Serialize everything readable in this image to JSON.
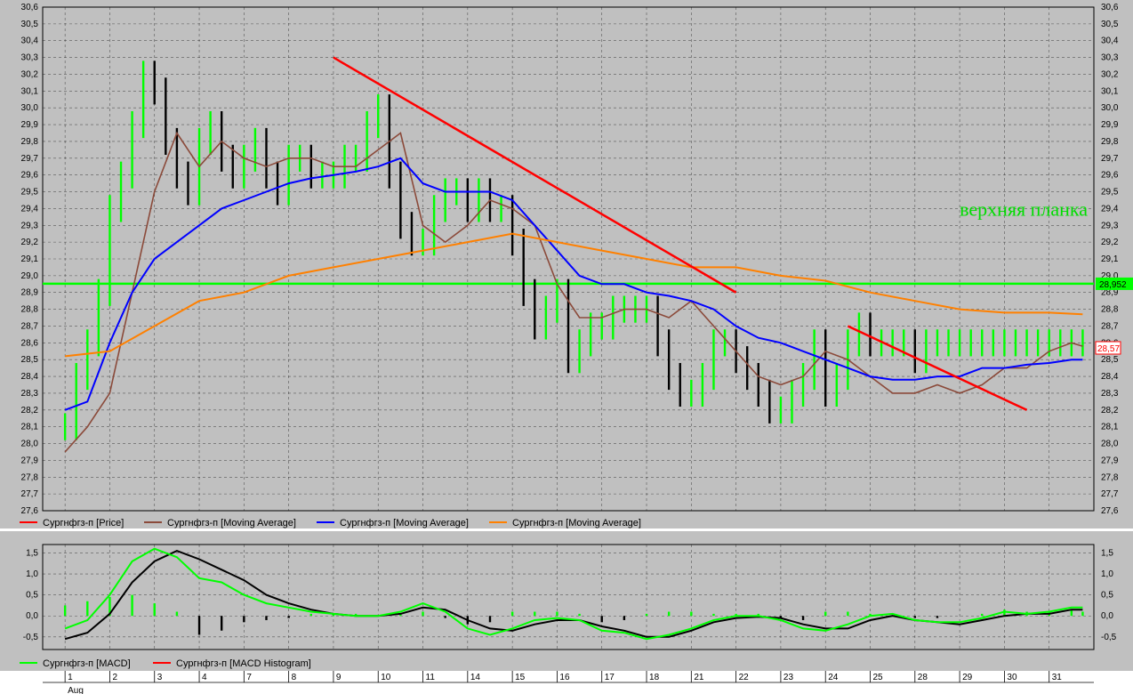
{
  "chart_data": [
    {
      "type": "line",
      "panel": "price",
      "ylim": [
        27.6,
        30.6
      ],
      "yticks": [
        27.6,
        27.7,
        27.8,
        27.9,
        28.0,
        28.1,
        28.2,
        28.3,
        28.4,
        28.5,
        28.6,
        28.7,
        28.8,
        28.9,
        29.0,
        29.1,
        29.2,
        29.3,
        29.4,
        29.5,
        29.6,
        29.7,
        29.8,
        29.9,
        30.0,
        30.1,
        30.2,
        30.3,
        30.4,
        30.5,
        30.6
      ],
      "ytick_labels": [
        "27,6",
        "27,7",
        "27,8",
        "27,9",
        "28,0",
        "28,1",
        "28,2",
        "28,3",
        "28,4",
        "28,5",
        "28,6",
        "28,7",
        "28,8",
        "28,9",
        "29,0",
        "29,1",
        "29,2",
        "29,3",
        "29,4",
        "29,5",
        "29,6",
        "29,7",
        "29,8",
        "29,9",
        "30,0",
        "30,1",
        "30,2",
        "30,3",
        "30,4",
        "30,5",
        "30,6"
      ],
      "grid": true,
      "x_categories": [
        "1",
        "2",
        "3",
        "4",
        "7",
        "8",
        "9",
        "10",
        "11",
        "14",
        "15",
        "16",
        "17",
        "18",
        "21",
        "22",
        "23",
        "24",
        "25",
        "28",
        "29",
        "30",
        "31"
      ],
      "x_month_label": "Aug",
      "series": [
        {
          "name": "Сургнфгз-п [Price]",
          "color": "#00ff00",
          "style": "bars",
          "x": [
            0,
            0.25,
            0.5,
            0.75,
            1,
            1.25,
            1.5,
            1.75,
            2,
            2.25,
            2.5,
            2.75,
            3,
            3.25,
            3.5,
            3.75,
            4,
            4.25,
            4.5,
            4.75,
            5,
            5.25,
            5.5,
            5.75,
            6,
            6.25,
            6.5,
            6.75,
            7,
            7.25,
            7.5,
            7.75,
            8,
            8.25,
            8.5,
            8.75,
            9,
            9.25,
            9.5,
            9.75,
            10,
            10.25,
            10.5,
            10.75,
            11,
            11.25,
            11.5,
            11.75,
            12,
            12.25,
            12.5,
            12.75,
            13,
            13.25,
            13.5,
            13.75,
            14,
            14.25,
            14.5,
            14.75,
            15,
            15.25,
            15.5,
            15.75,
            16,
            16.25,
            16.5,
            16.75,
            17,
            17.25,
            17.5,
            17.75,
            18,
            18.25,
            18.5,
            18.75,
            19,
            19.25,
            19.5,
            19.75,
            20,
            20.25,
            20.5,
            20.75,
            21,
            21.25,
            21.5,
            21.75,
            22,
            22.25,
            22.5,
            22.75
          ],
          "close": [
            28.1,
            28.4,
            28.6,
            28.9,
            29.4,
            29.6,
            29.9,
            30.2,
            30.1,
            29.8,
            29.6,
            29.5,
            29.8,
            29.9,
            29.7,
            29.6,
            29.7,
            29.8,
            29.6,
            29.5,
            29.7,
            29.7,
            29.6,
            29.6,
            29.6,
            29.7,
            29.7,
            29.9,
            30.0,
            29.6,
            29.3,
            29.2,
            29.2,
            29.4,
            29.5,
            29.5,
            29.4,
            29.5,
            29.4,
            29.4,
            29.2,
            28.9,
            28.7,
            28.8,
            28.9,
            28.5,
            28.6,
            28.7,
            28.7,
            28.8,
            28.8,
            28.8,
            28.8,
            28.6,
            28.4,
            28.3,
            28.3,
            28.4,
            28.6,
            28.6,
            28.5,
            28.4,
            28.3,
            28.2,
            28.2,
            28.3,
            28.4,
            28.6,
            28.3,
            28.4,
            28.6,
            28.7,
            28.6,
            28.6,
            28.6,
            28.6,
            28.5,
            28.6,
            28.6,
            28.6,
            28.6,
            28.6,
            28.6,
            28.6,
            28.6,
            28.6,
            28.6,
            28.6,
            28.6,
            28.6,
            28.6,
            28.6
          ]
        },
        {
          "name": "Сургнфгз-п [Moving Average]",
          "color": "#8b4a3a",
          "x": [
            0,
            0.5,
            1,
            1.5,
            2,
            2.5,
            3,
            3.5,
            4,
            4.5,
            5,
            5.5,
            6,
            6.5,
            7,
            7.5,
            8,
            8.5,
            9,
            9.5,
            10,
            10.5,
            11,
            11.5,
            12,
            12.5,
            13,
            13.5,
            14,
            14.5,
            15,
            15.5,
            16,
            16.5,
            17,
            17.5,
            18,
            18.5,
            19,
            19.5,
            20,
            20.5,
            21,
            21.5,
            22,
            22.5,
            22.75
          ],
          "values": [
            27.95,
            28.1,
            28.3,
            28.9,
            29.5,
            29.85,
            29.65,
            29.8,
            29.7,
            29.65,
            29.7,
            29.7,
            29.65,
            29.65,
            29.75,
            29.85,
            29.3,
            29.2,
            29.3,
            29.45,
            29.4,
            29.3,
            28.95,
            28.75,
            28.75,
            28.8,
            28.8,
            28.75,
            28.85,
            28.7,
            28.55,
            28.4,
            28.35,
            28.4,
            28.55,
            28.5,
            28.4,
            28.3,
            28.3,
            28.35,
            28.3,
            28.35,
            28.45,
            28.45,
            28.55,
            28.6,
            28.58
          ]
        },
        {
          "name": "Сургнфгз-п [Moving Average]",
          "color": "#0000ff",
          "x": [
            0,
            0.5,
            1,
            1.5,
            2,
            2.5,
            3,
            3.5,
            4,
            4.5,
            5,
            5.5,
            6,
            6.5,
            7,
            7.5,
            8,
            8.5,
            9,
            9.5,
            10,
            10.5,
            11,
            11.5,
            12,
            12.5,
            13,
            13.5,
            14,
            14.5,
            15,
            15.5,
            16,
            16.5,
            17,
            17.5,
            18,
            18.5,
            19,
            19.5,
            20,
            20.5,
            21,
            21.5,
            22,
            22.5,
            22.75
          ],
          "values": [
            28.2,
            28.25,
            28.6,
            28.9,
            29.1,
            29.2,
            29.3,
            29.4,
            29.45,
            29.5,
            29.55,
            29.58,
            29.6,
            29.62,
            29.65,
            29.7,
            29.55,
            29.5,
            29.5,
            29.5,
            29.45,
            29.3,
            29.15,
            29.0,
            28.95,
            28.95,
            28.9,
            28.88,
            28.85,
            28.8,
            28.7,
            28.63,
            28.6,
            28.55,
            28.5,
            28.45,
            28.4,
            28.38,
            28.38,
            28.4,
            28.4,
            28.45,
            28.45,
            28.47,
            28.48,
            28.5,
            28.5
          ]
        },
        {
          "name": "Сургнфгз-п [Moving Average]",
          "color": "#ff8000",
          "x": [
            0,
            1,
            2,
            3,
            4,
            5,
            6,
            7,
            8,
            9,
            10,
            11,
            12,
            13,
            14,
            15,
            16,
            17,
            18,
            19,
            20,
            21,
            22,
            22.75
          ],
          "values": [
            28.52,
            28.55,
            28.7,
            28.85,
            28.9,
            29.0,
            29.05,
            29.1,
            29.15,
            29.2,
            29.25,
            29.2,
            29.15,
            29.1,
            29.05,
            29.05,
            29.0,
            28.97,
            28.9,
            28.85,
            28.8,
            28.78,
            28.78,
            28.77
          ]
        }
      ],
      "annotations": [
        {
          "type": "hline",
          "value": 28.952,
          "color": "#00ff00",
          "label": "28,952"
        },
        {
          "type": "trendline",
          "color": "#ff0000",
          "x": [
            6,
            15
          ],
          "values": [
            30.3,
            28.9
          ]
        },
        {
          "type": "trendline",
          "color": "#ff0000",
          "x": [
            17.5,
            21.5
          ],
          "values": [
            28.7,
            28.2
          ]
        },
        {
          "type": "text",
          "text": "верхняя планка",
          "color": "#00dd00",
          "x": 20.0,
          "value": 29.4
        },
        {
          "type": "price_marker",
          "value": 28.57,
          "label": "28,57",
          "color": "#ff0000"
        }
      ],
      "legend": [
        {
          "label": "Сургнфгз-п [Price]",
          "color": "#ff0000"
        },
        {
          "label": "Сургнфгз-п [Moving Average]",
          "color": "#8b4a3a"
        },
        {
          "label": "Сургнфгз-п [Moving Average]",
          "color": "#0000ff"
        },
        {
          "label": "Сургнфгз-п [Moving Average]",
          "color": "#ff8000"
        }
      ]
    },
    {
      "type": "line",
      "panel": "macd",
      "ylim": [
        -0.8,
        1.7
      ],
      "yticks": [
        -0.5,
        0.0,
        0.5,
        1.0,
        1.5
      ],
      "ytick_labels": [
        "-0,5",
        "0,0",
        "0,5",
        "1,0",
        "1,5"
      ],
      "grid": true,
      "series": [
        {
          "name": "Сургнфгз-п [MACD]",
          "color": "#00ff00",
          "x": [
            0,
            0.5,
            1,
            1.5,
            2,
            2.5,
            3,
            3.5,
            4,
            4.5,
            5,
            5.5,
            6,
            6.5,
            7,
            7.5,
            8,
            8.5,
            9,
            9.5,
            10,
            10.5,
            11,
            11.5,
            12,
            12.5,
            13,
            13.5,
            14,
            14.5,
            15,
            15.5,
            16,
            16.5,
            17,
            17.5,
            18,
            18.5,
            19,
            19.5,
            20,
            20.5,
            21,
            21.5,
            22,
            22.5,
            22.75
          ],
          "values": [
            -0.3,
            -0.1,
            0.5,
            1.3,
            1.6,
            1.4,
            0.9,
            0.8,
            0.5,
            0.3,
            0.2,
            0.1,
            0.05,
            0.0,
            0.0,
            0.1,
            0.3,
            0.1,
            -0.3,
            -0.45,
            -0.3,
            -0.1,
            -0.05,
            -0.1,
            -0.35,
            -0.4,
            -0.55,
            -0.45,
            -0.3,
            -0.1,
            0.0,
            0.0,
            -0.1,
            -0.3,
            -0.35,
            -0.2,
            0.0,
            0.05,
            -0.1,
            -0.15,
            -0.15,
            -0.05,
            0.1,
            0.05,
            0.1,
            0.2,
            0.2
          ]
        },
        {
          "name": "Сургнфгз-п [MACD Histogram]",
          "color": "#00ff00",
          "style": "histogram",
          "x": [
            0,
            0.5,
            1,
            1.5,
            2,
            2.5,
            3,
            3.5,
            4,
            4.5,
            5,
            5.5,
            6,
            6.5,
            7,
            7.5,
            8,
            8.5,
            9,
            9.5,
            10,
            10.5,
            11,
            11.5,
            12,
            12.5,
            13,
            13.5,
            14,
            14.5,
            15,
            15.5,
            16,
            16.5,
            17,
            17.5,
            18,
            18.5,
            19,
            19.5,
            20,
            20.5,
            21,
            21.5,
            22,
            22.5,
            22.75
          ],
          "values": [
            0.25,
            0.35,
            0.45,
            0.5,
            0.3,
            0.1,
            -0.45,
            -0.35,
            -0.15,
            -0.1,
            -0.05,
            0.05,
            0.05,
            0.05,
            0.0,
            0.05,
            0.1,
            -0.05,
            -0.2,
            -0.15,
            0.1,
            0.1,
            0.1,
            0.05,
            -0.15,
            -0.1,
            0.05,
            0.1,
            0.1,
            0.05,
            0.05,
            0.05,
            -0.05,
            -0.1,
            0.1,
            0.1,
            0.05,
            0.0,
            -0.05,
            -0.05,
            0.0,
            0.05,
            0.15,
            0.1,
            0.1,
            0.15,
            0.1
          ]
        },
        {
          "name": "",
          "color": "#000000",
          "x": [
            0,
            0.5,
            1,
            1.5,
            2,
            2.5,
            3,
            3.5,
            4,
            4.5,
            5,
            5.5,
            6,
            6.5,
            7,
            7.5,
            8,
            8.5,
            9,
            9.5,
            10,
            10.5,
            11,
            11.5,
            12,
            12.5,
            13,
            13.5,
            14,
            14.5,
            15,
            15.5,
            16,
            16.5,
            17,
            17.5,
            18,
            18.5,
            19,
            19.5,
            20,
            20.5,
            21,
            21.5,
            22,
            22.5,
            22.75
          ],
          "values": [
            -0.55,
            -0.4,
            0.05,
            0.8,
            1.3,
            1.55,
            1.35,
            1.1,
            0.85,
            0.5,
            0.3,
            0.15,
            0.05,
            0.0,
            0.0,
            0.05,
            0.2,
            0.15,
            -0.1,
            -0.3,
            -0.35,
            -0.2,
            -0.1,
            -0.1,
            -0.25,
            -0.35,
            -0.5,
            -0.5,
            -0.35,
            -0.15,
            -0.05,
            -0.02,
            -0.05,
            -0.2,
            -0.3,
            -0.3,
            -0.1,
            0.0,
            -0.1,
            -0.15,
            -0.2,
            -0.1,
            0.0,
            0.05,
            0.05,
            0.15,
            0.15
          ]
        }
      ],
      "legend": [
        {
          "label": "Сургнфгз-п [MACD]",
          "color": "#00ff00"
        },
        {
          "label": "Сургнфгз-п [MACD Histogram]",
          "color": "#ff0000"
        }
      ]
    }
  ]
}
